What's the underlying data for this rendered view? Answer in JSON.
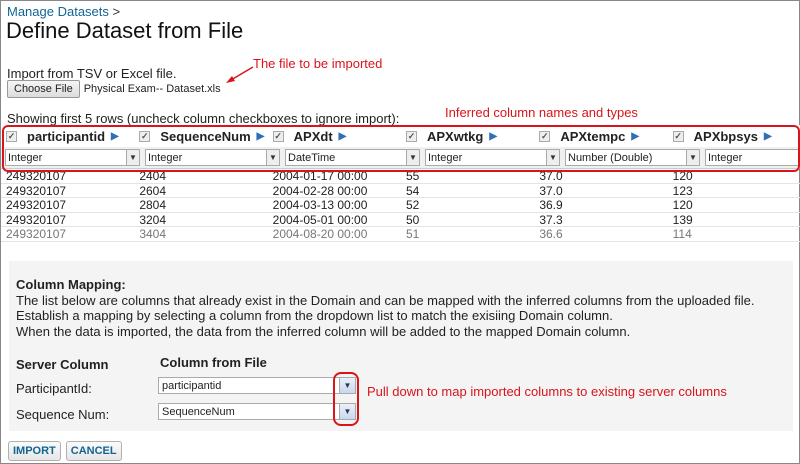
{
  "breadcrumb": {
    "link": "Manage Datasets",
    "separator": ">"
  },
  "title": "Define Dataset from File",
  "import": {
    "label": "Import from TSV or Excel file.",
    "choose_file_label": "Choose File",
    "file_name": "Physical Exam-- Dataset.xls"
  },
  "annotations": {
    "file": "The file to be imported",
    "inferred": "Inferred column names and types",
    "pulldown": "Pull down to map imported columns to existing server columns"
  },
  "showing_text": "Showing first 5 rows (uncheck column checkboxes to ignore import):",
  "columns": [
    {
      "name": "participantid",
      "type": "Integer",
      "checked": true
    },
    {
      "name": "SequenceNum",
      "type": "Integer",
      "checked": true
    },
    {
      "name": "APXdt",
      "type": "DateTime",
      "checked": true
    },
    {
      "name": "APXwtkg",
      "type": "Integer",
      "checked": true
    },
    {
      "name": "APXtempc",
      "type": "Number (Double)",
      "checked": true
    },
    {
      "name": "APXbpsys",
      "type": "Integer",
      "checked": true
    }
  ],
  "rows": [
    [
      "249320107",
      "2404",
      "2004-01-17 00:00",
      "55",
      "37.0",
      "120"
    ],
    [
      "249320107",
      "2604",
      "2004-02-28 00:00",
      "54",
      "37.0",
      "123"
    ],
    [
      "249320107",
      "2804",
      "2004-03-13 00:00",
      "52",
      "36.9",
      "120"
    ],
    [
      "249320107",
      "3204",
      "2004-05-01 00:00",
      "50",
      "37.3",
      "139"
    ],
    [
      "249320107",
      "3404",
      "2004-08-20 00:00",
      "51",
      "36.6",
      "114"
    ]
  ],
  "mapping": {
    "heading": "Column Mapping:",
    "desc1": "The list below are columns that already exist in the Domain and can be mapped with the inferred columns from the uploaded file.",
    "desc2": "Establish a mapping by selecting a column from the dropdown list to match the exisiing Domain column.",
    "desc3": "When the data is imported, the data from the inferred column will be added to the mapped Domain column.",
    "server_col_head": "Server Column",
    "file_col_head": "Column from File",
    "rows": [
      {
        "server": "ParticipantId:",
        "file": "participantid"
      },
      {
        "server": "Sequence Num:",
        "file": "SequenceNum"
      }
    ]
  },
  "buttons": {
    "import": "IMPORT",
    "cancel": "CANCEL"
  }
}
